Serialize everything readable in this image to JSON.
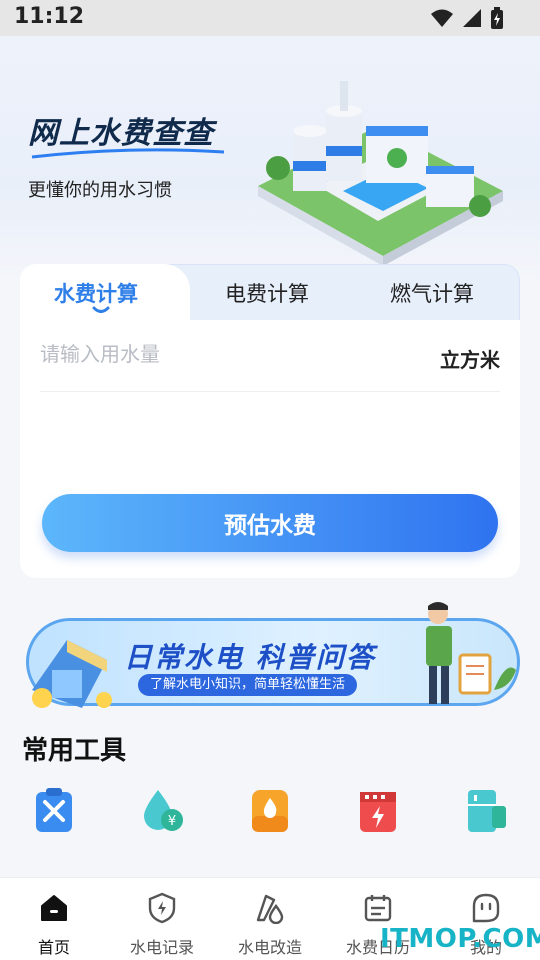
{
  "status_bar": {
    "time": "11:12",
    "icons": [
      "wifi-icon",
      "signal-icon",
      "battery-icon"
    ]
  },
  "hero": {
    "title": "网上水费查查",
    "subtitle": "更懂你的用水习惯",
    "illustration": "water-plant-illustration"
  },
  "calculator": {
    "tabs": [
      {
        "label": "水费计算",
        "active": true
      },
      {
        "label": "电费计算",
        "active": false
      },
      {
        "label": "燃气计算",
        "active": false
      }
    ],
    "input_placeholder": "请输入用水量",
    "input_value": "",
    "unit": "立方米",
    "button_label": "预估水费"
  },
  "banner": {
    "title": "日常水电 科普问答",
    "subtitle": "了解水电小知识，简单轻松懂生活"
  },
  "tools": {
    "title": "常用工具",
    "items": [
      {
        "icon": "repair-tools-icon",
        "color": "#3b8cf0"
      },
      {
        "icon": "water-fee-icon",
        "color": "#3ec7c9"
      },
      {
        "icon": "gas-icon",
        "color": "#f5a623"
      },
      {
        "icon": "electric-meter-icon",
        "color": "#ee4b4b"
      },
      {
        "icon": "fridge-icon",
        "color": "#3ec7c9"
      }
    ]
  },
  "tabbar": {
    "items": [
      {
        "label": "首页",
        "icon": "home-icon",
        "active": true
      },
      {
        "label": "水电记录",
        "icon": "shield-bolt-icon",
        "active": false
      },
      {
        "label": "水电改造",
        "icon": "renovation-icon",
        "active": false
      },
      {
        "label": "水费日历",
        "icon": "calendar-icon",
        "active": false
      },
      {
        "label": "我的",
        "icon": "profile-icon",
        "active": false
      }
    ]
  },
  "watermark": "ITMOP.COM",
  "colors": {
    "accent": "#2f7fe8",
    "button_start": "#5db7fb",
    "button_end": "#2f73f0",
    "banner_title": "#1d4fc6"
  }
}
